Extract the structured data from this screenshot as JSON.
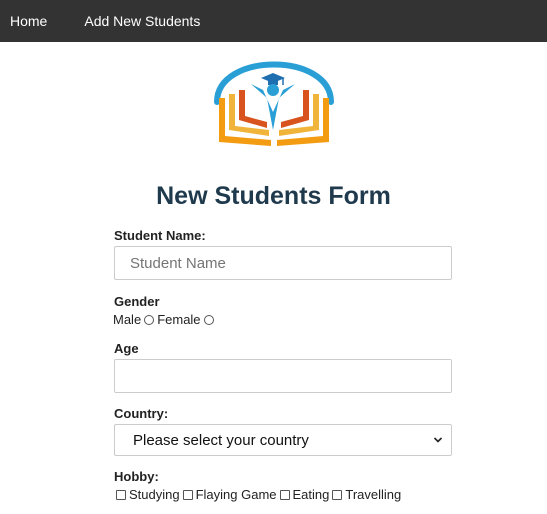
{
  "nav": {
    "home": "Home",
    "add_new_students": "Add New Students"
  },
  "logo": {
    "icon": "education-book-graduate-logo"
  },
  "form": {
    "title": "New Students Form",
    "student_name": {
      "label": "Student Name:",
      "placeholder": "Student Name",
      "value": ""
    },
    "gender": {
      "label": "Gender",
      "options": [
        "Male",
        "Female"
      ]
    },
    "age": {
      "label": "Age",
      "value": ""
    },
    "country": {
      "label": "Country:",
      "selected": "Please select your country"
    },
    "hobby": {
      "label": "Hobby:",
      "options": [
        "Studying",
        "Flaying Game",
        "Eating",
        "Travelling"
      ]
    }
  },
  "colors": {
    "navbar": "#333333",
    "title": "#1f3a4d",
    "logo_blue": "#2a9fd6",
    "logo_orange": "#f39c12",
    "logo_red": "#d9531e"
  }
}
